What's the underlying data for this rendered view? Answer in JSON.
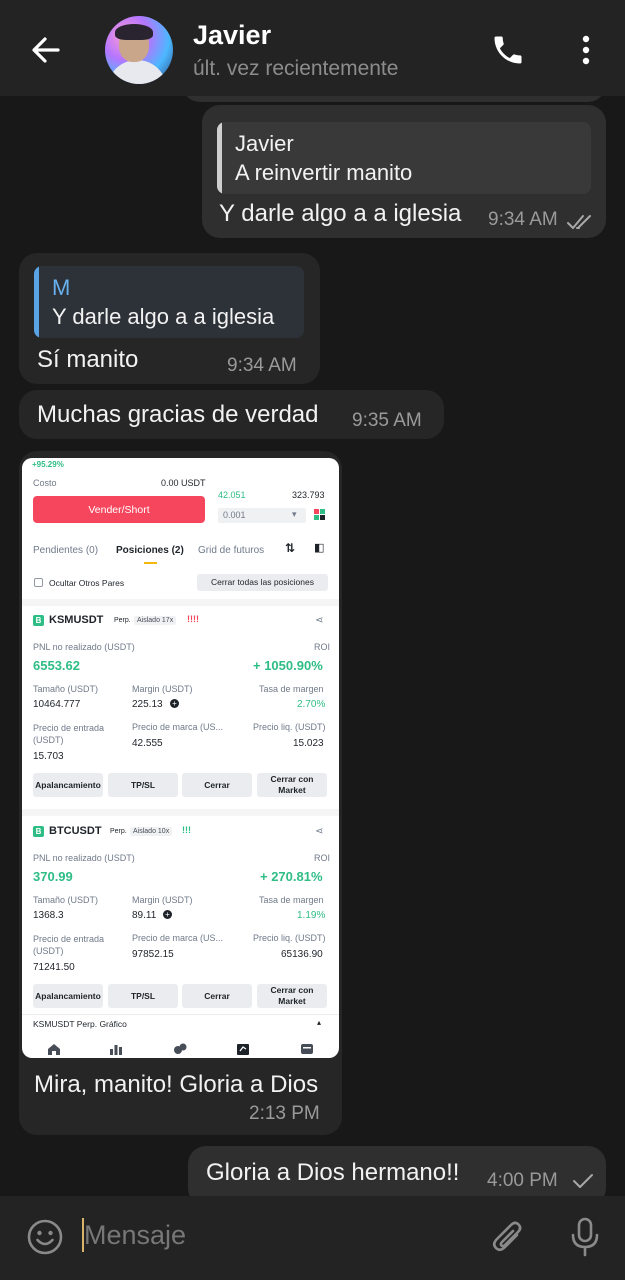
{
  "header": {
    "title": "Javier",
    "status": "últ. vez recientemente"
  },
  "messages": {
    "m1": {
      "quote_name": "Javier",
      "quote_text": "A reinvertir manito",
      "text": "Y darle algo a a iglesia",
      "time": "9:34 AM"
    },
    "m2": {
      "quote_name": "M",
      "quote_text": "Y darle algo a a iglesia",
      "text": "Sí manito",
      "time": "9:34 AM"
    },
    "m3": {
      "text": "Muchas gracias de verdad",
      "time": "9:35 AM"
    },
    "m4": {
      "caption": "Mira, manito! Gloria a Dios",
      "time": "2:13 PM"
    },
    "m5": {
      "text": "Gloria a Dios hermano!!",
      "time": "4:00 PM"
    }
  },
  "screenshot": {
    "top_pct": "+95.29%",
    "costo_label": "Costo",
    "costo_value": "0.00 USDT",
    "price_green": "42.051",
    "price_right": "323.793",
    "sell_button": "Vender/Short",
    "qty_value": "0.001",
    "tabs": {
      "pendientes": "Pendientes (0)",
      "posiciones": "Posiciones (2)",
      "grid": "Grid de futuros"
    },
    "hide_pairs": "Ocultar Otros Pares",
    "close_all": "Cerrar todas las posiciones",
    "labels": {
      "pnl": "PNL no realizado (USDT)",
      "roi": "ROI",
      "size": "Tamaño (USDT)",
      "margin": "Margin (USDT)",
      "margin_rate": "Tasa de margen",
      "entry": "Precio de entrada (USDT)",
      "mark": "Precio de marca (US...",
      "liq": "Precio liq. (USDT)"
    },
    "positions": [
      {
        "symbol": "KSMUSDT",
        "perp": "Perp.",
        "mode": "Aislado 17x",
        "flag": "!!!!",
        "pnl": "6553.62",
        "roi": "+ 1050.90%",
        "size": "10464.777",
        "margin": "225.13",
        "margin_rate": "2.70%",
        "entry": "15.703",
        "mark": "42.555",
        "liq": "15.023"
      },
      {
        "symbol": "BTCUSDT",
        "perp": "Perp.",
        "mode": "Aislado 10x",
        "flag": "!!!",
        "pnl": "370.99",
        "roi": "+ 270.81%",
        "size": "1368.3",
        "margin": "89.11",
        "margin_rate": "1.19%",
        "entry": "71241.50",
        "mark": "97852.15",
        "liq": "65136.90"
      }
    ],
    "buttons": {
      "leverage": "Apalancamiento",
      "tpsl": "TP/SL",
      "close": "Cerrar",
      "close_market": "Cerrar con Market"
    },
    "chart_row": "KSMUSDT Perp. Gráfico"
  },
  "input": {
    "placeholder": "Mensaje"
  },
  "colors": {
    "header": "#232323",
    "background": "#181818",
    "incoming": "#262626",
    "outgoing": "#2f2f2f",
    "accent_blue": "#5aa4e6",
    "green": "#2ebd85",
    "red": "#f6465d"
  }
}
